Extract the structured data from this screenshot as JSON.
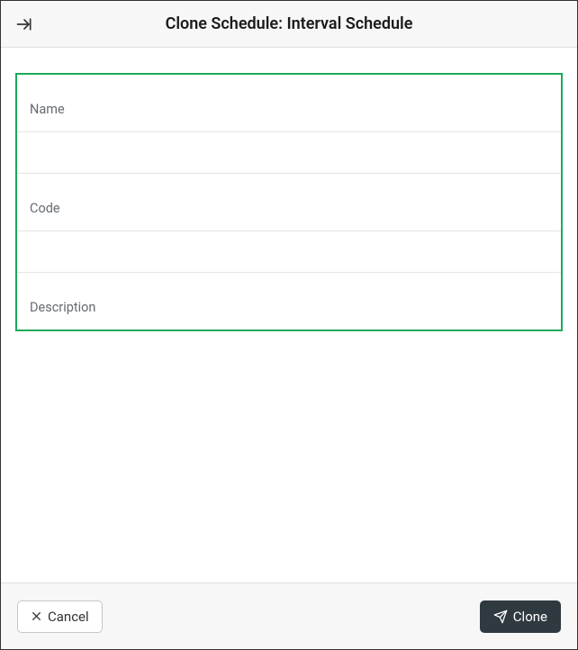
{
  "header": {
    "title": "Clone Schedule: Interval Schedule"
  },
  "form": {
    "name": {
      "label": "Name",
      "value": ""
    },
    "code": {
      "label": "Code",
      "value": ""
    },
    "description": {
      "label": "Description",
      "value": ""
    }
  },
  "footer": {
    "cancel_label": "Cancel",
    "clone_label": "Clone"
  }
}
